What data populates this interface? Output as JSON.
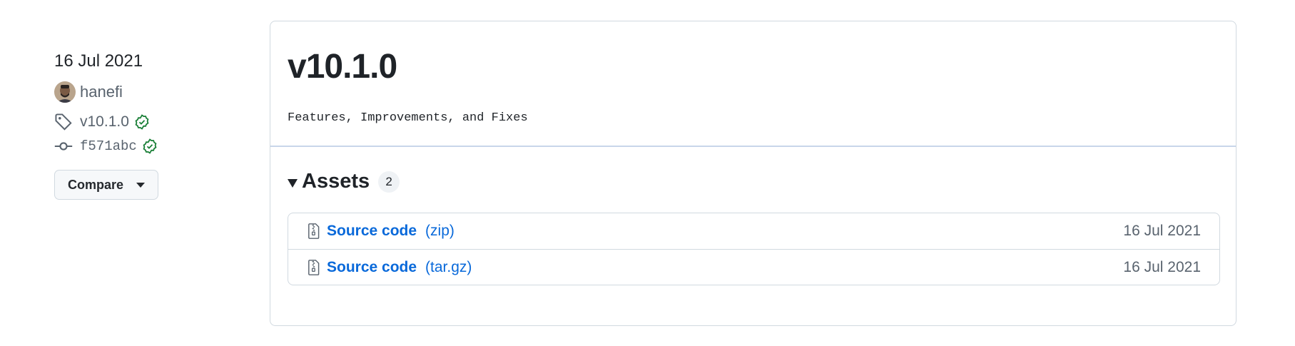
{
  "sidebar": {
    "date": "16 Jul 2021",
    "author": "hanefi",
    "tag": "v10.1.0",
    "commit": "f571abc",
    "compare_label": "Compare"
  },
  "release": {
    "title": "v10.1.0",
    "description": "Features, Improvements, and Fixes"
  },
  "assets": {
    "title": "Assets",
    "count": "2",
    "items": [
      {
        "name": "Source code",
        "ext": "(zip)",
        "date": "16 Jul 2021"
      },
      {
        "name": "Source code",
        "ext": "(tar.gz)",
        "date": "16 Jul 2021"
      }
    ]
  },
  "colors": {
    "link": "#0969da",
    "verified": "#1a7f37",
    "muted": "#59636e",
    "border": "#d1d9e0"
  }
}
